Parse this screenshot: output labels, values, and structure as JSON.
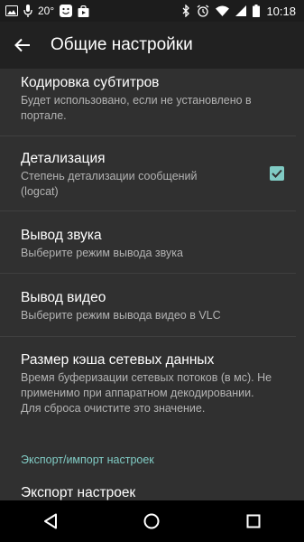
{
  "status_bar": {
    "temperature": "20°",
    "time": "10:18",
    "icons": [
      "image-icon",
      "microphone-icon",
      "temperature",
      "emoji-icon",
      "bag-icon",
      "bluetooth-icon",
      "alarm-icon",
      "wifi-icon",
      "cell-signal-icon",
      "battery-icon"
    ]
  },
  "toolbar": {
    "title": "Общие настройки",
    "back_icon": "back-arrow-icon"
  },
  "settings": {
    "subtitles": {
      "title": "Кодировка субтитров",
      "summary": "Будет использовано, если не установлено в портале."
    },
    "logging": {
      "title": "Детализация",
      "summary": "Степень детализации сообщений (logcat)",
      "checked": true
    },
    "audio_output": {
      "title": "Вывод звука",
      "summary": "Выберите режим вывода звука"
    },
    "video_output": {
      "title": "Вывод видео",
      "summary": "Выберите режим вывода видео в VLC"
    },
    "network_cache": {
      "title": "Размер кэша сетевых данных",
      "summary": "Время буферизации сетевых потоков (в мс). Не применимо при аппаратном декодировании. Для сброса очистите это значение."
    },
    "category_export": "Экспорт/импорт настроек",
    "export": {
      "title": "Экспорт настроек"
    }
  },
  "colors": {
    "accent": "#80cbc4",
    "background": "#303030",
    "toolbar": "#212121"
  },
  "nav_bar": {
    "icons": [
      "back-triangle-icon",
      "home-circle-icon",
      "recents-square-icon"
    ]
  }
}
